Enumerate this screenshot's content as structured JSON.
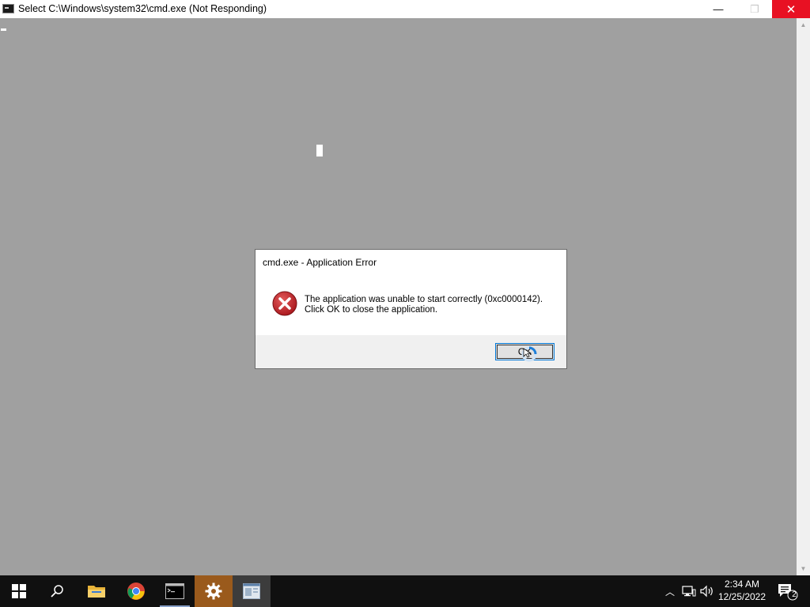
{
  "window": {
    "title": "Select C:\\Windows\\system32\\cmd.exe (Not Responding)",
    "minimize_glyph": "—",
    "maximize_glyph": "❐",
    "close_glyph": "✕"
  },
  "dialog": {
    "title": "cmd.exe - Application Error",
    "message_line1": "The application was unable to start correctly (0xc0000142).",
    "message_line2": "Click OK to close the application.",
    "ok_label": "OK",
    "icon": "error-icon"
  },
  "taskbar": {
    "items": [
      "start",
      "search",
      "file-explorer",
      "chrome",
      "command-prompt",
      "settings",
      "app-window"
    ],
    "tray": {
      "time": "2:34 AM",
      "date": "12/25/2022",
      "notification_count": "2"
    }
  },
  "colors": {
    "console_bg": "#a0a0a0",
    "close_button": "#e81123",
    "error_red": "#c4262e",
    "taskbar_bg": "#101010",
    "settings_active": "#9a5a1c"
  }
}
